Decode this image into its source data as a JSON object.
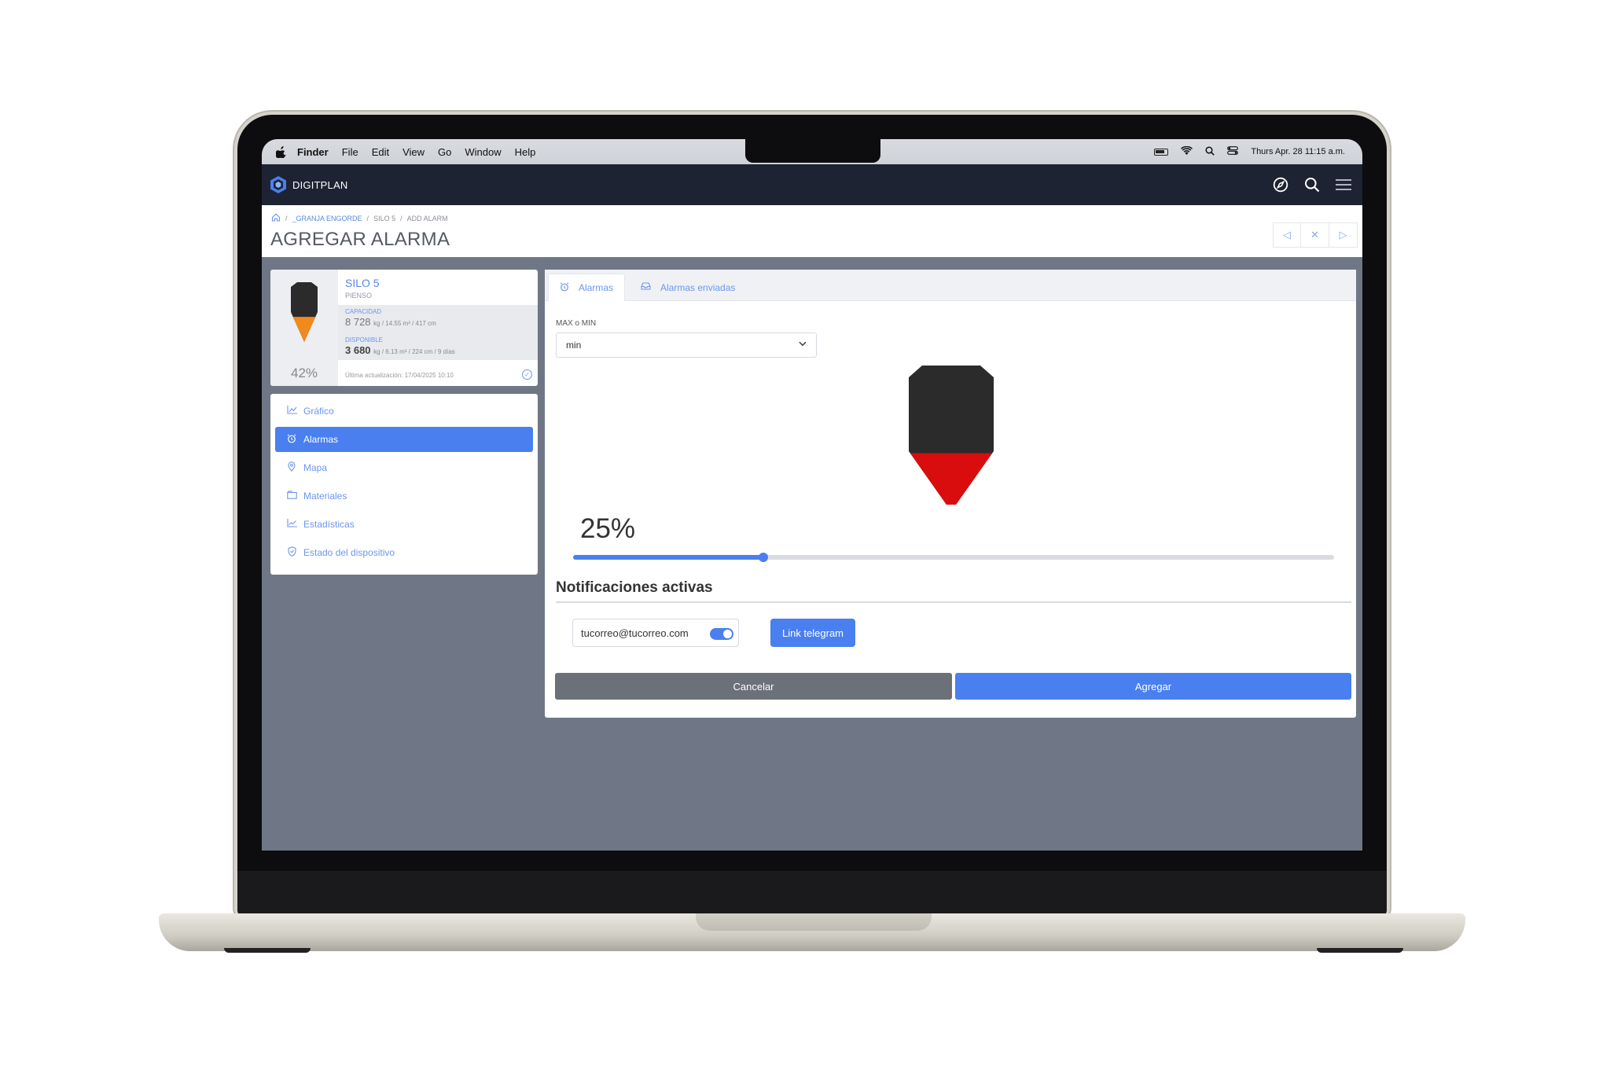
{
  "menubar": {
    "app": "Finder",
    "items": [
      "File",
      "Edit",
      "View",
      "Go",
      "Window",
      "Help"
    ],
    "clock": "Thurs Apr. 28 11:15 a.m."
  },
  "appbar": {
    "brand": "DIGITPLAN"
  },
  "breadcrumb": {
    "sep": "/",
    "farm": "_GRANJA ENGORDE",
    "silo": "SILO 5",
    "page": "ADD ALARM"
  },
  "page_title": "AGREGAR ALARMA",
  "silo_card": {
    "name": "SILO 5",
    "type": "PIENSO",
    "capacity_label": "CAPACIDAD",
    "capacity_value": "8 728",
    "capacity_unit": "kg / 14.55 m³ / 417 cm",
    "available_label": "DISPONIBLE",
    "available_value": "3 680",
    "available_unit": "kg / 6.13 m³ / 224 cm / 9 días",
    "fill_percent": "42%",
    "fill_level": 0.42,
    "updated": "Última actualización: 17/04/2025 10:10"
  },
  "side_nav": {
    "items": [
      {
        "label": "Gráfico",
        "icon": "chart-icon"
      },
      {
        "label": "Alarmas",
        "icon": "alarm-clock-icon",
        "active": true
      },
      {
        "label": "Mapa",
        "icon": "map-pin-icon"
      },
      {
        "label": "Materiales",
        "icon": "box-icon"
      },
      {
        "label": "Estadísticas",
        "icon": "stats-icon"
      },
      {
        "label": "Estado del dispositivo",
        "icon": "shield-icon"
      }
    ]
  },
  "tabs": [
    {
      "label": "Alarmas",
      "icon": "alarm-clock-icon",
      "active": true
    },
    {
      "label": "Alarmas enviadas",
      "icon": "inbox-icon"
    }
  ],
  "form": {
    "maxmin_label": "MAX o MIN",
    "maxmin_value": "min",
    "level_label": "25%",
    "level_value": 0.25,
    "notifications_title": "Notificaciones activas",
    "email": "tucorreo@tucorreo.com",
    "email_enabled": true,
    "telegram_button": "Link telegram",
    "cancel_button": "Cancelar",
    "add_button": "Agregar"
  },
  "colors": {
    "accent": "#4a7ff0",
    "appbar": "#1d2333",
    "silo_dark": "#2b2b2b",
    "silo_card_fill": "#f08a1c",
    "alarm_fill": "#d90d0d",
    "cancel": "#6c7079"
  }
}
